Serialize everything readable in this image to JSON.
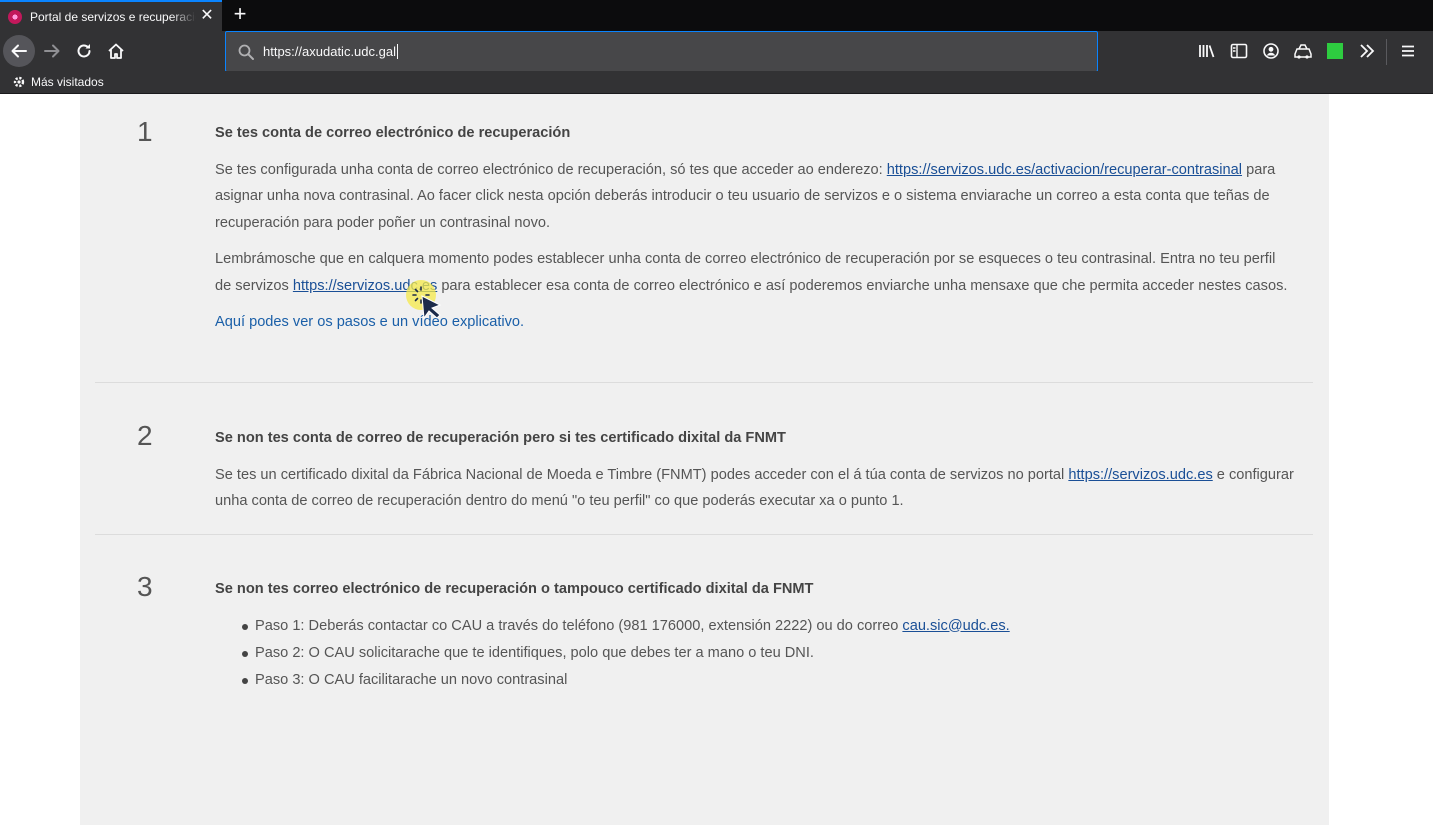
{
  "browser": {
    "tab_title": "Portal de servizos e recuperación",
    "tab_close_label": "✕",
    "new_tab_label": "+",
    "url": "https://axudatic.udc.gal",
    "bookmark_label": "Más visitados",
    "accent_color": "#0a84ff"
  },
  "sections": [
    {
      "number": "1",
      "title": "Se tes conta de correo electrónico de recuperación",
      "p1_text_a": "Se tes configurada unha conta de correo electrónico de recuperación, só tes que acceder ao enderezo: ",
      "p1_link": "https://servizos.udc.es/activacion/recuperar-contrasinal",
      "p1_text_b": " para asignar unha nova contrasinal. Ao facer click nesta opción deberás introducir o teu usuario de servizos e o sistema enviarache un correo a esta conta que teñas de recuperación para poder poñer un contrasinal novo.",
      "p2_text_a": "Lembrámosche que en calquera momento podes establecer unha conta de correo electrónico de recuperación por se esqueces o teu contrasinal. Entra no teu perfil de servizos ",
      "p2_link": "https://servizos.udc.es",
      "p2_text_b": " para establecer esa conta de correo electrónico e así poderemos enviarche unha mensaxe que che permita acceder nestes casos.",
      "video_link": "Aquí podes ver os pasos e un vídeo explicativo."
    },
    {
      "number": "2",
      "title": "Se non tes conta de correo de recuperación pero si tes certificado dixital da FNMT",
      "p1_text_a": "Se tes un certificado dixital da Fábrica Nacional de Moeda e Timbre (FNMT) podes acceder con el á túa conta de servizos no portal  ",
      "p1_link": "https://servizos.udc.es",
      "p1_text_b": " e configurar unha conta de correo de recuperación dentro do menú \"o teu perfil\" co que poderás executar xa o punto 1."
    },
    {
      "number": "3",
      "title": "Se non tes correo electrónico de recuperación o tampouco certificado dixital da FNMT",
      "step1_text": "Paso 1: Deberás contactar co CAU a través do teléfono (981 176000, extensión 2222) ou do correo ",
      "step1_link": "cau.sic@udc.es.",
      "step2_text": "Paso 2: O CAU solicitarache que te identifiques, polo que debes ter a mano o teu DNI.",
      "step3_text": "Paso 3: O CAU facilitarache un novo contrasinal"
    }
  ]
}
